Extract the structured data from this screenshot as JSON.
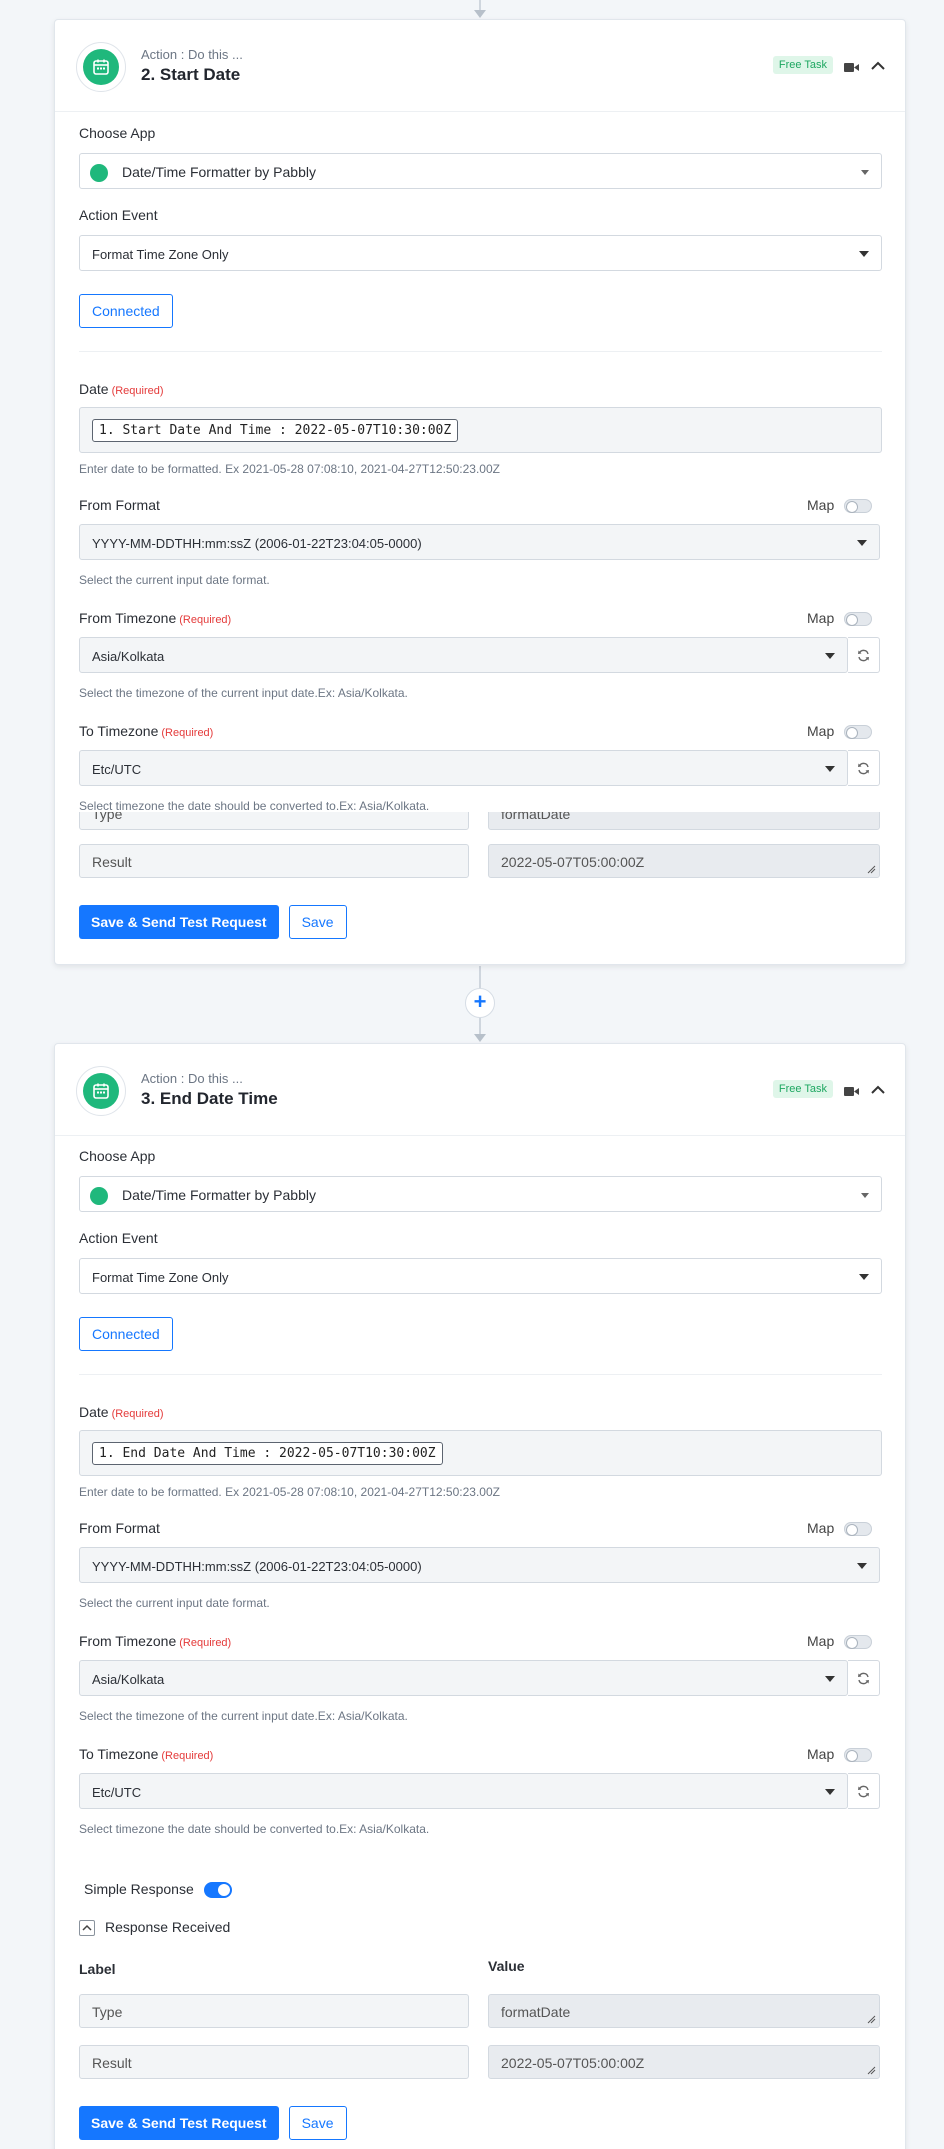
{
  "steps": [
    {
      "action_sub": "Action : Do this ...",
      "title": "2. Start Date",
      "badge": "Free Task",
      "choose_app_label": "Choose App",
      "app_name": "Date/Time Formatter by Pabbly",
      "action_event_label": "Action Event",
      "action_event_value": "Format Time Zone Only",
      "connected_label": "Connected",
      "date_label": "Date",
      "required": "(Required)",
      "date_value": "1. Start Date And Time : 2022-05-07T10:30:00Z",
      "date_help": "Enter date to be formatted. Ex 2021-05-28 07:08:10, 2021-04-27T12:50:23.00Z",
      "from_format_label": "From Format",
      "map_label": "Map",
      "from_format_value": "YYYY-MM-DDTHH:mm:ssZ (2006-01-22T23:04:05-0000)",
      "from_format_help": "Select the current input date format.",
      "from_tz_label": "From Timezone",
      "from_tz_value": "Asia/Kolkata",
      "from_tz_help": "Select the timezone of the current input date.Ex: Asia/Kolkata.",
      "to_tz_label": "To Timezone",
      "to_tz_value": "Etc/UTC",
      "to_tz_help": "Select timezone the date should be converted to.Ex: Asia/Kolkata.",
      "type_label": "Type",
      "type_value": "formatDate",
      "result_label": "Result",
      "result_value": "2022-05-07T05:00:00Z",
      "save_send_label": "Save & Send Test Request",
      "save_label": "Save"
    },
    {
      "action_sub": "Action : Do this ...",
      "title": "3. End Date Time",
      "badge": "Free Task",
      "choose_app_label": "Choose App",
      "app_name": "Date/Time Formatter by Pabbly",
      "action_event_label": "Action Event",
      "action_event_value": "Format Time Zone Only",
      "connected_label": "Connected",
      "date_label": "Date",
      "required": "(Required)",
      "date_value": "1. End Date And Time : 2022-05-07T10:30:00Z",
      "date_help": "Enter date to be formatted. Ex 2021-05-28 07:08:10, 2021-04-27T12:50:23.00Z",
      "from_format_label": "From Format",
      "map_label": "Map",
      "from_format_value": "YYYY-MM-DDTHH:mm:ssZ (2006-01-22T23:04:05-0000)",
      "from_format_help": "Select the current input date format.",
      "from_tz_label": "From Timezone",
      "from_tz_value": "Asia/Kolkata",
      "from_tz_help": "Select the timezone of the current input date.Ex: Asia/Kolkata.",
      "to_tz_label": "To Timezone",
      "to_tz_value": "Etc/UTC",
      "to_tz_help": "Select timezone the date should be converted to.Ex: Asia/Kolkata.",
      "simple_response_label": "Simple Response",
      "response_received_label": "Response Received",
      "col_label": "Label",
      "col_value": "Value",
      "type_label": "Type",
      "type_value": "formatDate",
      "result_label": "Result",
      "result_value": "2022-05-07T05:00:00Z",
      "save_send_label": "Save & Send Test Request",
      "save_label": "Save"
    }
  ],
  "colors": {
    "primary": "#1577ff",
    "app_green": "#1fb87c",
    "required": "#e43a3a",
    "badge_bg": "#dff6e9",
    "badge_text": "#1ea761"
  }
}
